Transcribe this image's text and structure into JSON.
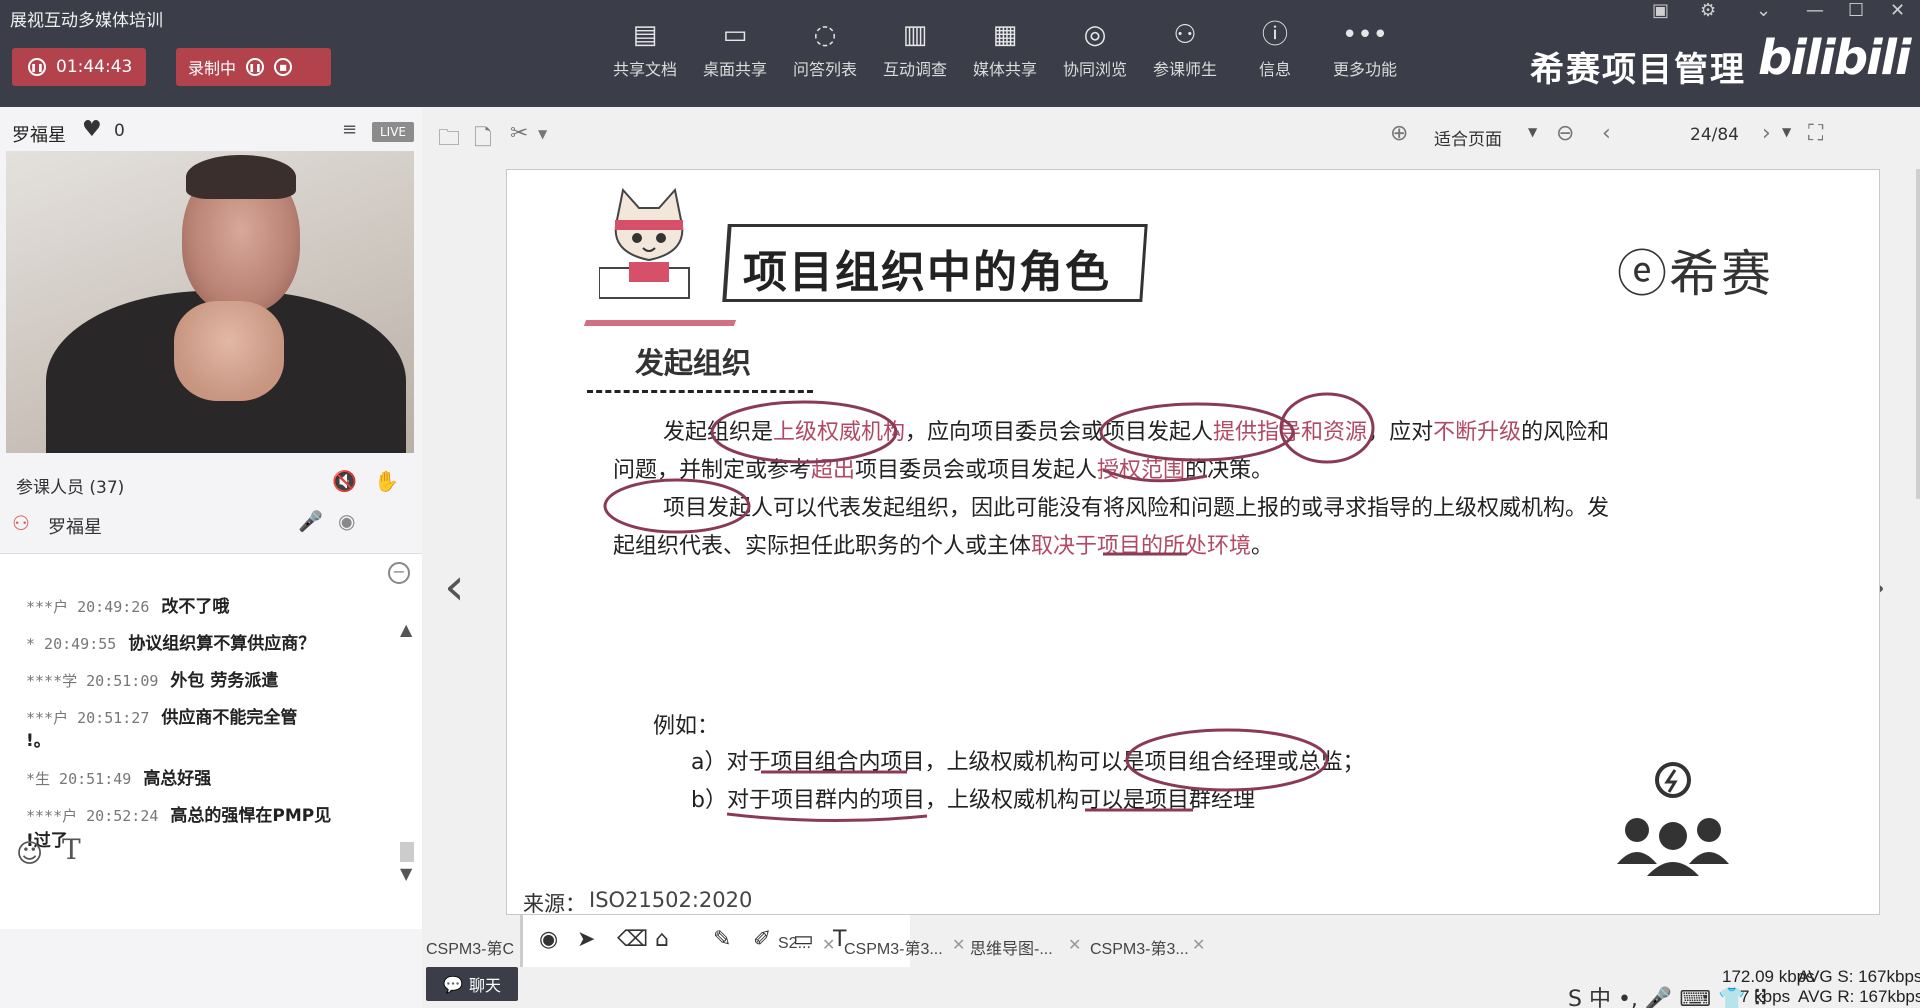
{
  "app": {
    "title": "展视互动多媒体培训"
  },
  "header": {
    "timer": "01:44:43",
    "record_label": "录制中",
    "brand": "希赛项目管理",
    "brand2": "bilibili",
    "tools": [
      {
        "label": "共享文档",
        "icon": "doc-share-icon"
      },
      {
        "label": "桌面共享",
        "icon": "desktop-share-icon"
      },
      {
        "label": "问答列表",
        "icon": "qa-icon"
      },
      {
        "label": "互动调查",
        "icon": "survey-icon"
      },
      {
        "label": "媒体共享",
        "icon": "media-icon"
      },
      {
        "label": "协同浏览",
        "icon": "browse-icon"
      },
      {
        "label": "参课师生",
        "icon": "people-icon"
      },
      {
        "label": "信息",
        "icon": "info-icon"
      },
      {
        "label": "更多功能",
        "icon": "more-icon"
      }
    ]
  },
  "left": {
    "presenter": "罗福星",
    "likes": "0",
    "live": "LIVE",
    "attendees_label": "参课人员 (37)",
    "attendee_name": "罗福星",
    "chat": [
      {
        "who": "***户 20:49:26",
        "text": "改不了哦"
      },
      {
        "who": "* 20:49:55",
        "text": "协议组织算不算供应商？"
      },
      {
        "who": "****学 20:51:09",
        "text": "外包  劳务派遣"
      },
      {
        "who": "***户 20:51:27",
        "text": "供应商不能完全管",
        "cont": "!。"
      },
      {
        "who": "*生 20:51:49",
        "text": "高总好强"
      },
      {
        "who": "****户 20:52:24",
        "text": "高总的强悍在PMP见",
        "cont": "!过了"
      }
    ],
    "chat_button": "聊天"
  },
  "toolbar": {
    "fit_page": "适合页面",
    "page": "24/84"
  },
  "slide": {
    "title": "项目组织中的角色",
    "logo": "希赛",
    "subtitle": "发起组织",
    "p1a": "发起组织是",
    "p1b": "上级权威机构",
    "p1c": "，应向项目委员会或项目发起人",
    "p1d": "提供指导和资源",
    "p1e": "，应对",
    "p1f": "不断升级",
    "p1g": "的风险和",
    "p2a": "问题，并制定或参考",
    "p2b": "超出",
    "p2c": "项目委员会或项目发起人",
    "p2d": "授权范围",
    "p2e": "的决策。",
    "p3a": "项目发起人",
    "p3b": "可以代表发起组织，因此可能没有将风险和问题上报的或寻求指导的上级权威机构。发",
    "p4a": "起组织代表、实际担任此职务的个人或主体",
    "p4b": "取决于项目的所处环境",
    "p4c": "。",
    "example_label": "例如：",
    "ex_a": "a）对于项目组合内项目，上级权威机构可以是项目组合经理或总监；",
    "ex_b": "b）对于项目群内的项目，上级权威机构可以是项目群经理",
    "source_label": "来源：",
    "source_value": "ISO21502:2020"
  },
  "tabs": [
    {
      "label": "CSPM3-第C"
    },
    {
      "label": "S2..."
    },
    {
      "label": "CSPM3-第3..."
    },
    {
      "label": "思维导图-..."
    },
    {
      "label": "CSPM3-第3..."
    }
  ],
  "stats": {
    "send": "172.09 kbps",
    "recv": "7 kbps",
    "avg_s": "AVG S: 167kbps",
    "avg_r": "AVG R: 167kbps"
  },
  "ime": "S 中 •, 🎤 ⌨ 👕 ⠿"
}
